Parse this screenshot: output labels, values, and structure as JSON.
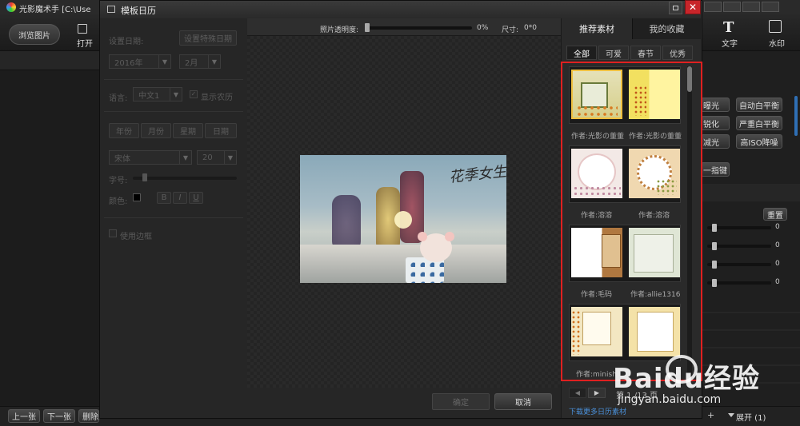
{
  "app": {
    "title": "光影魔术手 [C:\\Use",
    "browse_btn": "浏览图片",
    "open_label": "打开",
    "text_label": "文字",
    "watermark_label": "水印",
    "prev_btn": "上一张",
    "next_btn": "下一张",
    "delete_btn": "删除",
    "expand_label": "展开 (1)",
    "right_panel": {
      "buttons": [
        "曝光",
        "自动白平衡",
        "锐化",
        "严重白平衡",
        "减光",
        "高ISO降噪",
        "一指键"
      ],
      "reset": "重置",
      "slider_values": [
        "0",
        "0",
        "0",
        "0"
      ]
    }
  },
  "dialog": {
    "title": "模板日历",
    "left": {
      "date_label": "设置日期:",
      "set_special_date_btn": "设置特殊日期",
      "year_value": "2016年",
      "month_value": "2月",
      "language_label": "语言:",
      "language_value": "中文1",
      "show_lunar_label": "显示农历",
      "tabs": [
        "年份",
        "月份",
        "星期",
        "日期"
      ],
      "font_value": "宋体",
      "size_value": "20",
      "spacing_label": "字号:",
      "color_label": "颜色:",
      "style_buttons": [
        "B",
        "I",
        "U"
      ],
      "use_border_label": "使用边框"
    },
    "top": {
      "opacity_label": "照片透明度:",
      "opacity_value": "0%",
      "size_label": "尺寸:",
      "size_value": "0*0"
    },
    "preview": {
      "overlay_text": "花季女生"
    },
    "confirm_btn": "确定",
    "cancel_btn": "取消",
    "panel": {
      "tabs": [
        "推荐素材",
        "我的收藏"
      ],
      "categories": [
        "全部",
        "可爱",
        "春节",
        "优秀"
      ],
      "authors": [
        "作者:光影の董董",
        "作者:光影の董董",
        "作者:溶溶",
        "作者:溶溶",
        "作者:毛码",
        "作者:allie1316",
        "作者:minish",
        ""
      ],
      "page_text": "第 1 /13 页",
      "download_link": "下载更多日历素材"
    }
  },
  "watermark_brand": {
    "main": "Baidu经验",
    "sub": "jingyan.baidu.com"
  }
}
